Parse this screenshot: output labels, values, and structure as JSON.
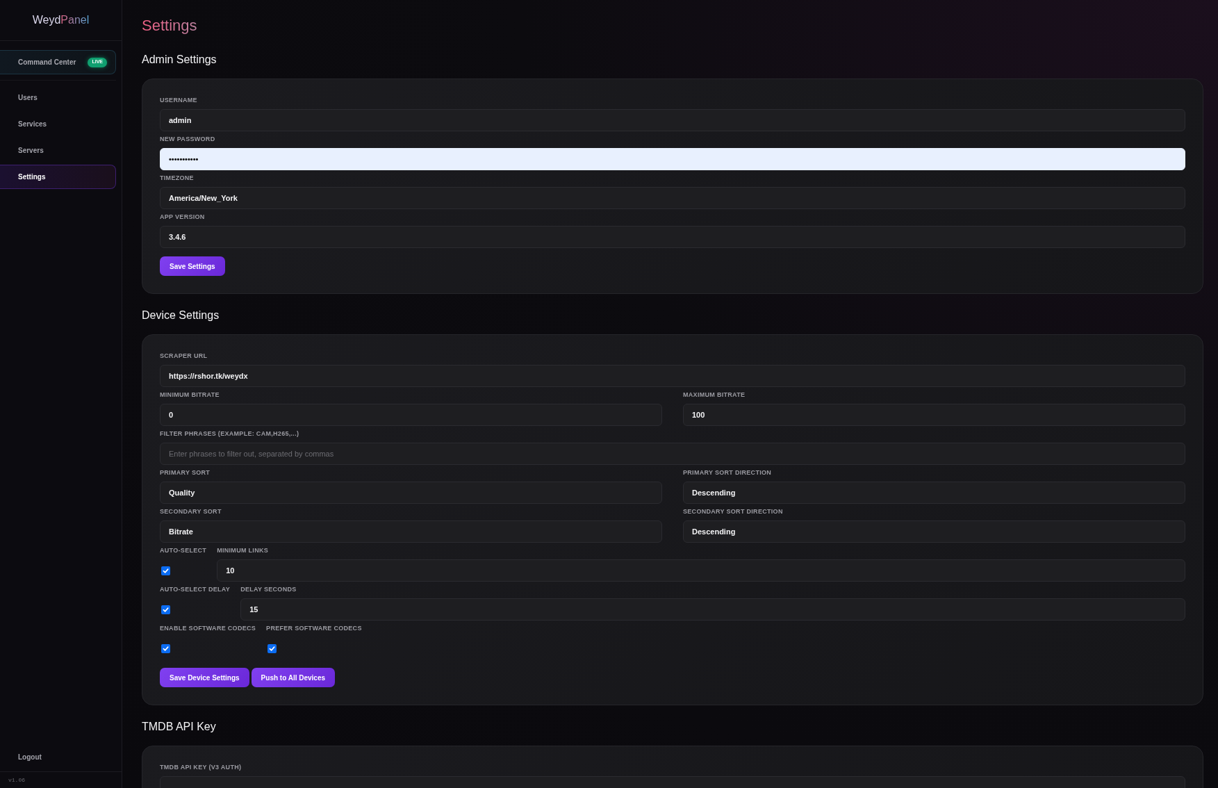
{
  "sidebar": {
    "logo": {
      "first": "Weyd",
      "second": "Panel"
    },
    "featured": {
      "label": "Command Center",
      "badge": "LIVE"
    },
    "items": [
      {
        "label": "Users",
        "selected": false
      },
      {
        "label": "Services",
        "selected": false
      },
      {
        "label": "Servers",
        "selected": false
      },
      {
        "label": "Settings",
        "selected": true
      }
    ],
    "logout": "Logout",
    "version": "v1.06"
  },
  "page_title": "Settings",
  "sections": [
    {
      "title": "Admin Settings",
      "rows": [
        [
          {
            "kind": "input",
            "label": "USERNAME",
            "value": "admin"
          }
        ],
        [
          {
            "kind": "input",
            "label": "NEW PASSWORD",
            "value": "•••••••••••",
            "autofilled": true
          }
        ],
        [
          {
            "kind": "input",
            "label": "TIMEZONE",
            "value": "America/New_York"
          }
        ],
        [
          {
            "kind": "input",
            "label": "APP VERSION",
            "value": "3.4.6"
          }
        ]
      ],
      "buttons": [
        "Save Settings"
      ]
    },
    {
      "title": "Device Settings",
      "rows": [
        [
          {
            "kind": "input",
            "label": "SCRAPER URL",
            "value": "https://rshor.tk/weydx"
          }
        ],
        [
          {
            "kind": "input",
            "label": "MINIMUM BITRATE",
            "value": "0"
          },
          {
            "kind": "input",
            "label": "MAXIMUM BITRATE",
            "value": "100"
          }
        ],
        [
          {
            "kind": "input",
            "label": "FILTER PHRASES (EXAMPLE: CAM,H265,...)",
            "placeholder": "Enter phrases to filter out, separated by commas"
          }
        ],
        [
          {
            "kind": "input",
            "label": "PRIMARY SORT",
            "value": "Quality"
          },
          {
            "kind": "input",
            "label": "PRIMARY SORT DIRECTION",
            "value": "Descending"
          }
        ],
        [
          {
            "kind": "input",
            "label": "SECONDARY SORT",
            "value": "Bitrate"
          },
          {
            "kind": "input",
            "label": "SECONDARY SORT DIRECTION",
            "value": "Descending"
          }
        ],
        [
          {
            "kind": "checkbox",
            "label": "AUTO-SELECT",
            "checked": true
          },
          {
            "kind": "input",
            "label": "MINIMUM LINKS",
            "value": "10"
          }
        ],
        [
          {
            "kind": "checkbox",
            "label": "AUTO-SELECT DELAY",
            "checked": true
          },
          {
            "kind": "input",
            "label": "DELAY SECONDS",
            "value": "15"
          }
        ],
        [
          {
            "kind": "checkbox",
            "label": "ENABLE SOFTWARE CODECS",
            "checked": true
          },
          {
            "kind": "checkbox",
            "label": "PREFER SOFTWARE CODECS",
            "checked": true
          }
        ]
      ],
      "buttons": [
        "Save Device Settings",
        "Push to All Devices"
      ]
    },
    {
      "title": "TMDB API Key",
      "rows": [
        [
          {
            "kind": "input",
            "label": "TMDB API KEY (V3 AUTH)"
          }
        ]
      ]
    }
  ]
}
